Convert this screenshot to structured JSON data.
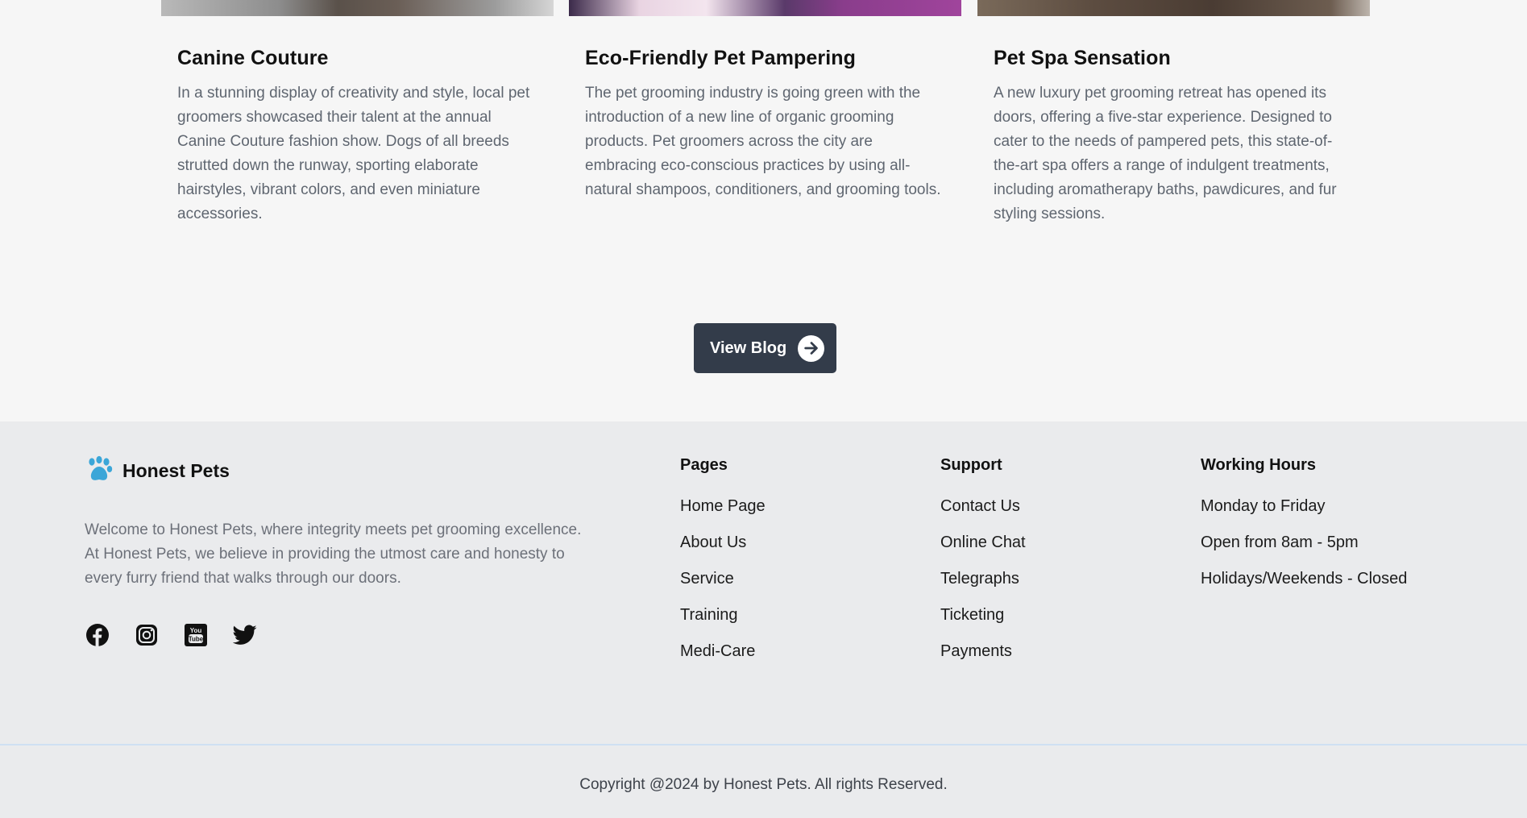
{
  "blog": {
    "cards": [
      {
        "title": "Canine Couture",
        "text": "In a stunning display of creativity and style, local pet groomers showcased their talent at the annual Canine Couture fashion show. Dogs of all breeds strutted down the runway, sporting elaborate hairstyles, vibrant colors, and even miniature accessories."
      },
      {
        "title": "Eco-Friendly Pet Pampering",
        "text": "The pet grooming industry is going green with the introduction of a new line of organic grooming products. Pet groomers across the city are embracing eco-conscious practices by using all-natural shampoos, conditioners, and grooming tools."
      },
      {
        "title": "Pet Spa Sensation",
        "text": "A new luxury pet grooming retreat has opened its doors, offering a five-star experience. Designed to cater to the needs of pampered pets, this state-of-the-art spa offers a range of indulgent treatments, including aromatherapy baths, pawdicures, and fur styling sessions."
      }
    ],
    "view_button": "View Blog"
  },
  "footer": {
    "brand": "Honest Pets",
    "about": "Welcome to Honest Pets, where integrity meets pet grooming excellence. At Honest Pets, we believe in providing the utmost care and honesty to every furry friend that walks through our doors.",
    "social_icons": [
      "facebook-icon",
      "instagram-icon",
      "youtube-icon",
      "twitter-icon"
    ],
    "pages": {
      "title": "Pages",
      "items": [
        "Home Page",
        "About Us",
        "Service",
        "Training",
        "Medi-Care"
      ]
    },
    "support": {
      "title": "Support",
      "items": [
        "Contact Us",
        "Online Chat",
        "Telegraphs",
        "Ticketing",
        "Payments"
      ]
    },
    "hours": {
      "title": "Working Hours",
      "items": [
        "Monday to Friday",
        "Open from 8am - 5pm",
        "Holidays/Weekends - Closed"
      ]
    },
    "copyright": "Copyright @2024 by Honest Pets. All rights Reserved."
  },
  "colors": {
    "button_bg": "#333c4a",
    "paw_accent": "#3ba6d8",
    "footer_bg": "#eaebed",
    "page_bg": "#f6f6f6"
  }
}
